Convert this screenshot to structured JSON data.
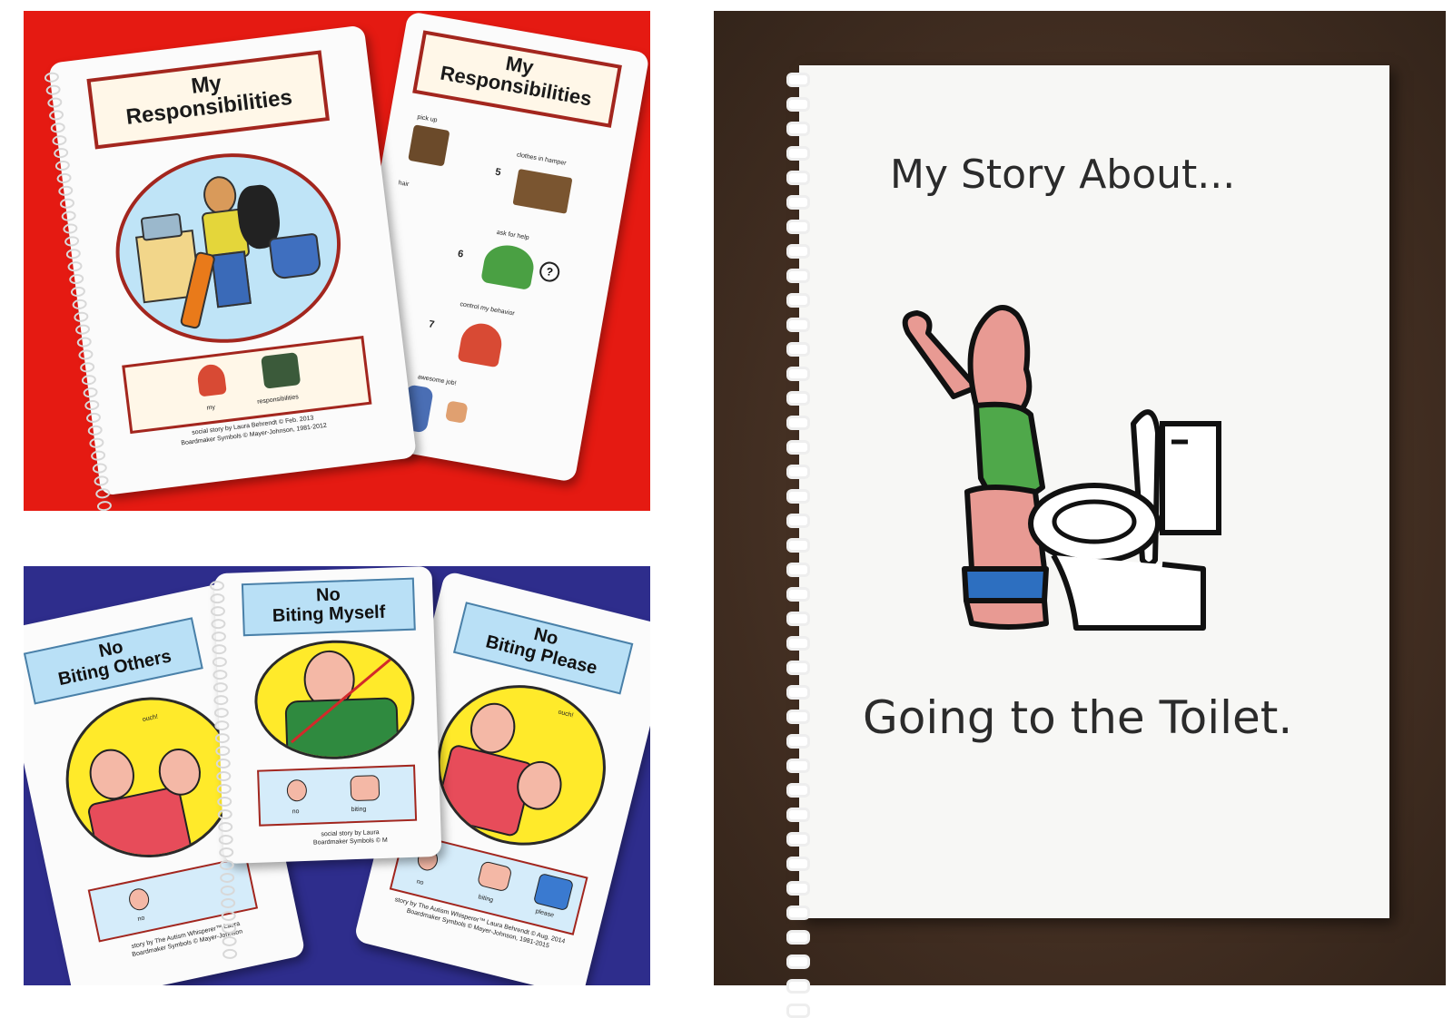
{
  "red_panel": {
    "front_title_line1": "My",
    "front_title_line2": "Responsibilities",
    "back_title_line1": "My",
    "back_title_line2": "Responsibilities",
    "strip_word_1": "my",
    "strip_word_2": "responsibilities",
    "credit_line1": "social story by Laura Behrendt © Feb. 2013",
    "credit_line2": "Boardmaker Symbols © Mayer-Johnson, 1981-2012",
    "list_items": [
      {
        "num": "",
        "label": "pick up"
      },
      {
        "num": "5",
        "label": "clothes in hamper"
      },
      {
        "num": "",
        "label": "hair"
      },
      {
        "num": "6",
        "label": "ask for help"
      },
      {
        "num": "7",
        "label": "control my behavior"
      },
      {
        "num": "",
        "label": "awesome job!"
      }
    ]
  },
  "blue_panel": {
    "book1_line1": "No",
    "book1_line2": "Biting Others",
    "book1_ouch": "ouch!",
    "book1_strip_word": "no",
    "book1_credit_line1": "story by The Autism Whisperer™ Laura",
    "book1_credit_line2": "Boardmaker Symbols © Mayer-Johnson",
    "book2_line1": "No",
    "book2_line2": "Biting Myself",
    "book2_strip_word_1": "no",
    "book2_strip_word_2": "biting",
    "book2_credit_line1": "social story by Laura",
    "book2_credit_line2": "Boardmaker Symbols © M",
    "book3_line1": "No",
    "book3_line2": "Biting Please",
    "book3_ouch": "ouch!",
    "book3_strip_word_1": "no",
    "book3_strip_word_2": "biting",
    "book3_strip_word_3": "please",
    "book3_credit_line1": "story by The Autism Whisperer™ Laura Behrendt © Aug. 2014",
    "book3_credit_line2": "Boardmaker Symbols © Mayer-Johnson, 1981-2015"
  },
  "toilet_panel": {
    "title": "My Story About...",
    "caption": "Going to the Toilet."
  },
  "colors": {
    "red_bg": "#e51a12",
    "blue_bg": "#2e2d8c",
    "brown_bg": "#4a3426",
    "frame_red": "#a3261e",
    "label_blue": "#b9e0f6",
    "circle_yellow": "#ffea2a",
    "shirt_green": "#4fa84a",
    "skin_pink": "#e89a93",
    "pants_blue": "#2d6fc0"
  }
}
